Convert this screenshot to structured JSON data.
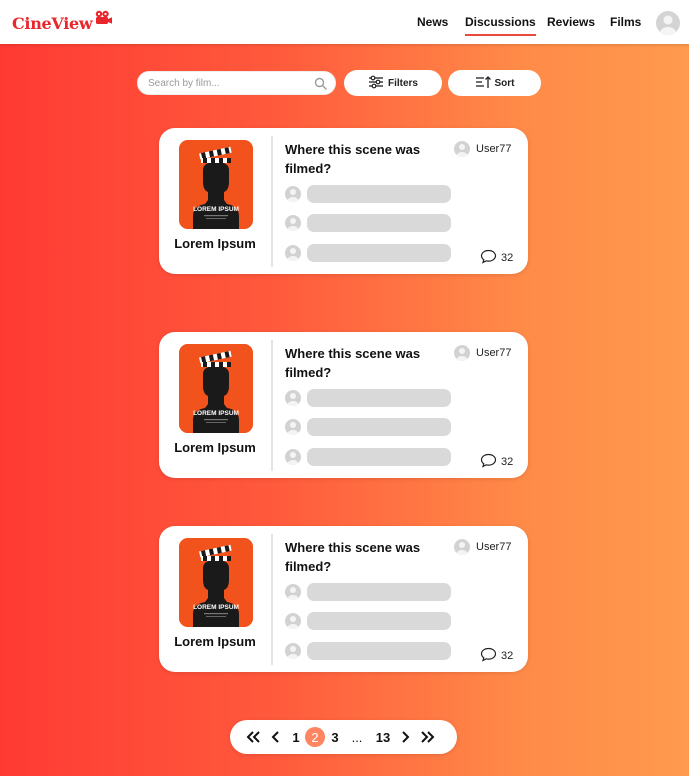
{
  "app": {
    "logo_text": "CineView",
    "brand_color": "#e8262c",
    "logo_icon": "film-camera-icon"
  },
  "nav": {
    "items": [
      {
        "label": "News",
        "active": false
      },
      {
        "label": "Discussions",
        "active": true
      },
      {
        "label": "Reviews",
        "active": false
      },
      {
        "label": "Films",
        "active": false
      }
    ],
    "profile_icon": "user-avatar-icon"
  },
  "toolbar": {
    "search_placeholder": "Search by film...",
    "search_value": "",
    "filters_label": "Filters",
    "filters_icon": "sliders-icon",
    "sort_label": "Sort",
    "sort_icon": "sort-icon"
  },
  "poster": {
    "text": "LOREM IPSUM"
  },
  "discussions": [
    {
      "film": "Lorem Ipsum",
      "question": "Where this scene was filmed?",
      "author": "User77",
      "comments": "32"
    },
    {
      "film": "Lorem Ipsum",
      "question": "Where this scene was filmed?",
      "author": "User77",
      "comments": "32"
    },
    {
      "film": "Lorem Ipsum",
      "question": "Where this scene was filmed?",
      "author": "User77",
      "comments": "32"
    }
  ],
  "pagination": {
    "pages": [
      "1",
      "2",
      "3",
      "...",
      "13"
    ],
    "current": "2",
    "first_icon": "double-chevron-left-icon",
    "prev_icon": "chevron-left-icon",
    "next_icon": "chevron-right-icon",
    "last_icon": "double-chevron-right-icon"
  },
  "colors": {
    "gradient_start": "#ff3a34",
    "gradient_end": "#ff9a4e",
    "accent": "#ff8460",
    "poster_bg": "#f2531d"
  }
}
